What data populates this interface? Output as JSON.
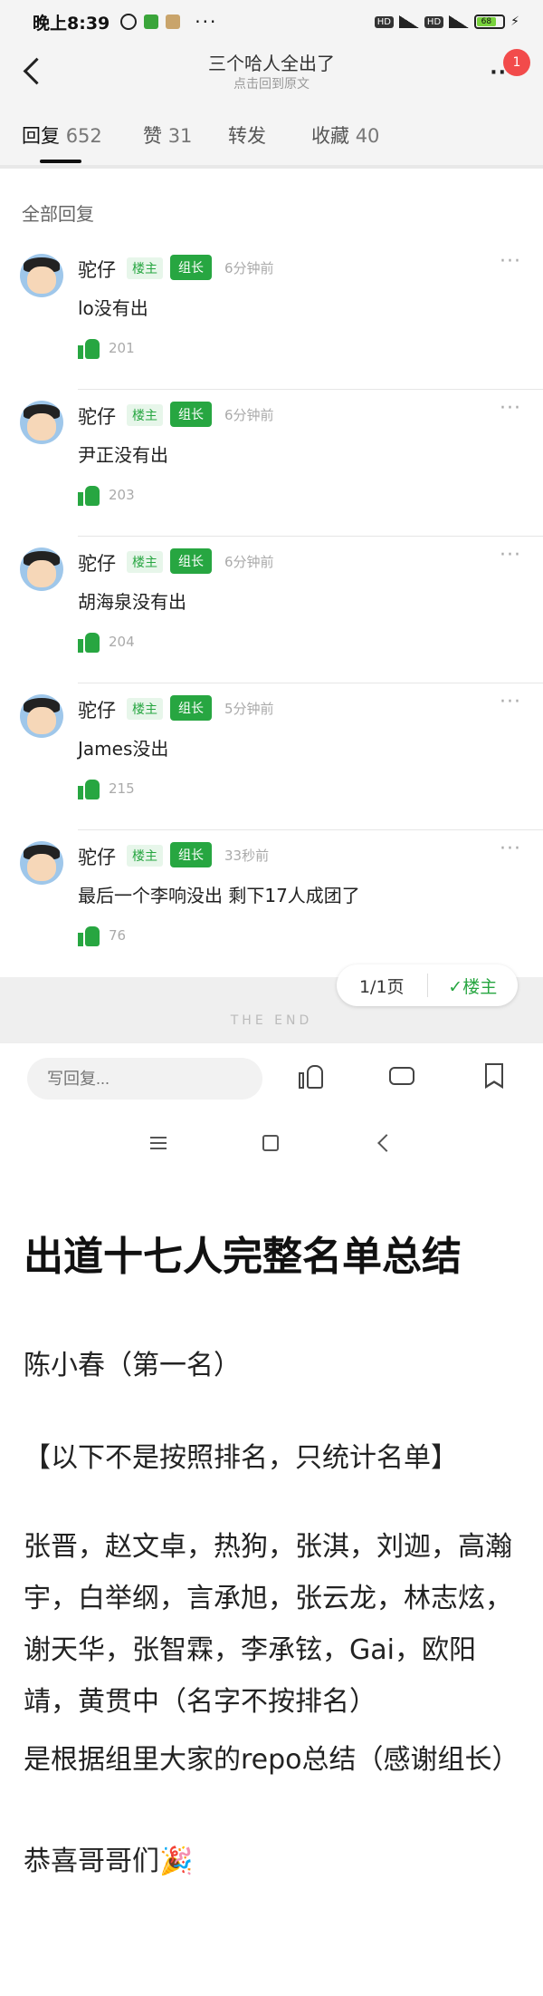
{
  "status_bar": {
    "time": "晚上8:39",
    "battery": "68",
    "dots": "···"
  },
  "header": {
    "title": "三个哈人全出了",
    "subtitle": "点击回到原文",
    "more": "··",
    "notification_count": "1"
  },
  "tabs": [
    {
      "label": "回复",
      "count": "652"
    },
    {
      "label": "赞",
      "count": "31"
    },
    {
      "label": "转发",
      "count": ""
    },
    {
      "label": "收藏",
      "count": "40"
    }
  ],
  "section_title": "全部回复",
  "replies": [
    {
      "user": "驼仔",
      "tag1": "楼主",
      "tag2": "组长",
      "time": "6分钟前",
      "text": "lo没有出",
      "likes": "201"
    },
    {
      "user": "驼仔",
      "tag1": "楼主",
      "tag2": "组长",
      "time": "6分钟前",
      "text": "尹正没有出",
      "likes": "203"
    },
    {
      "user": "驼仔",
      "tag1": "楼主",
      "tag2": "组长",
      "time": "6分钟前",
      "text": "胡海泉没有出",
      "likes": "204"
    },
    {
      "user": "驼仔",
      "tag1": "楼主",
      "tag2": "组长",
      "time": "5分钟前",
      "text": "James没出",
      "likes": "215"
    },
    {
      "user": "驼仔",
      "tag1": "楼主",
      "tag2": "组长",
      "time": "33秒前",
      "text": "最后一个李响没出 剩下17人成团了",
      "likes": "76"
    }
  ],
  "more_icon": "···",
  "pager": {
    "page": "1/1页",
    "louzhu": "✓楼主"
  },
  "the_end": "THE END",
  "bottom_bar": {
    "reply_placeholder": "写回复..."
  },
  "article": {
    "title": "出道十七人完整名单总结",
    "p1": "陈小春（第一名）",
    "p2": "【以下不是按照排名，只统计名单】",
    "p3": "张晋，赵文卓，热狗，张淇，刘迦，高瀚宇，白举纲，言承旭，张云龙，林志炫，谢天华，张智霖，李承铉，Gai，欧阳靖，黄贯中（名字不按排名）",
    "p4": "是根据组里大家的repo总结（感谢组长）",
    "p5": "恭喜哥哥们🎉"
  },
  "colors": {
    "accent": "#27a641",
    "badge": "#f24b4b"
  }
}
